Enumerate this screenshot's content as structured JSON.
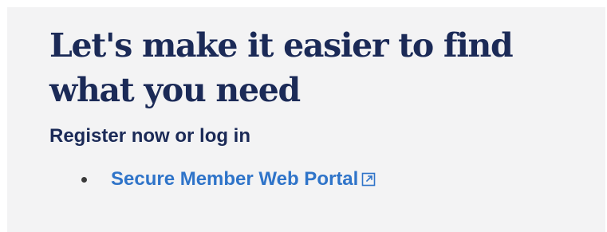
{
  "section": {
    "headline": "Let's make it easier to find what you need",
    "subhead": "Register now or log in",
    "links": [
      {
        "label": "Secure Member Web Portal",
        "icon": "external-link-icon"
      }
    ]
  },
  "colors": {
    "panel_bg": "#f3f3f4",
    "heading": "#1b2a57",
    "link": "#2f74c9"
  }
}
